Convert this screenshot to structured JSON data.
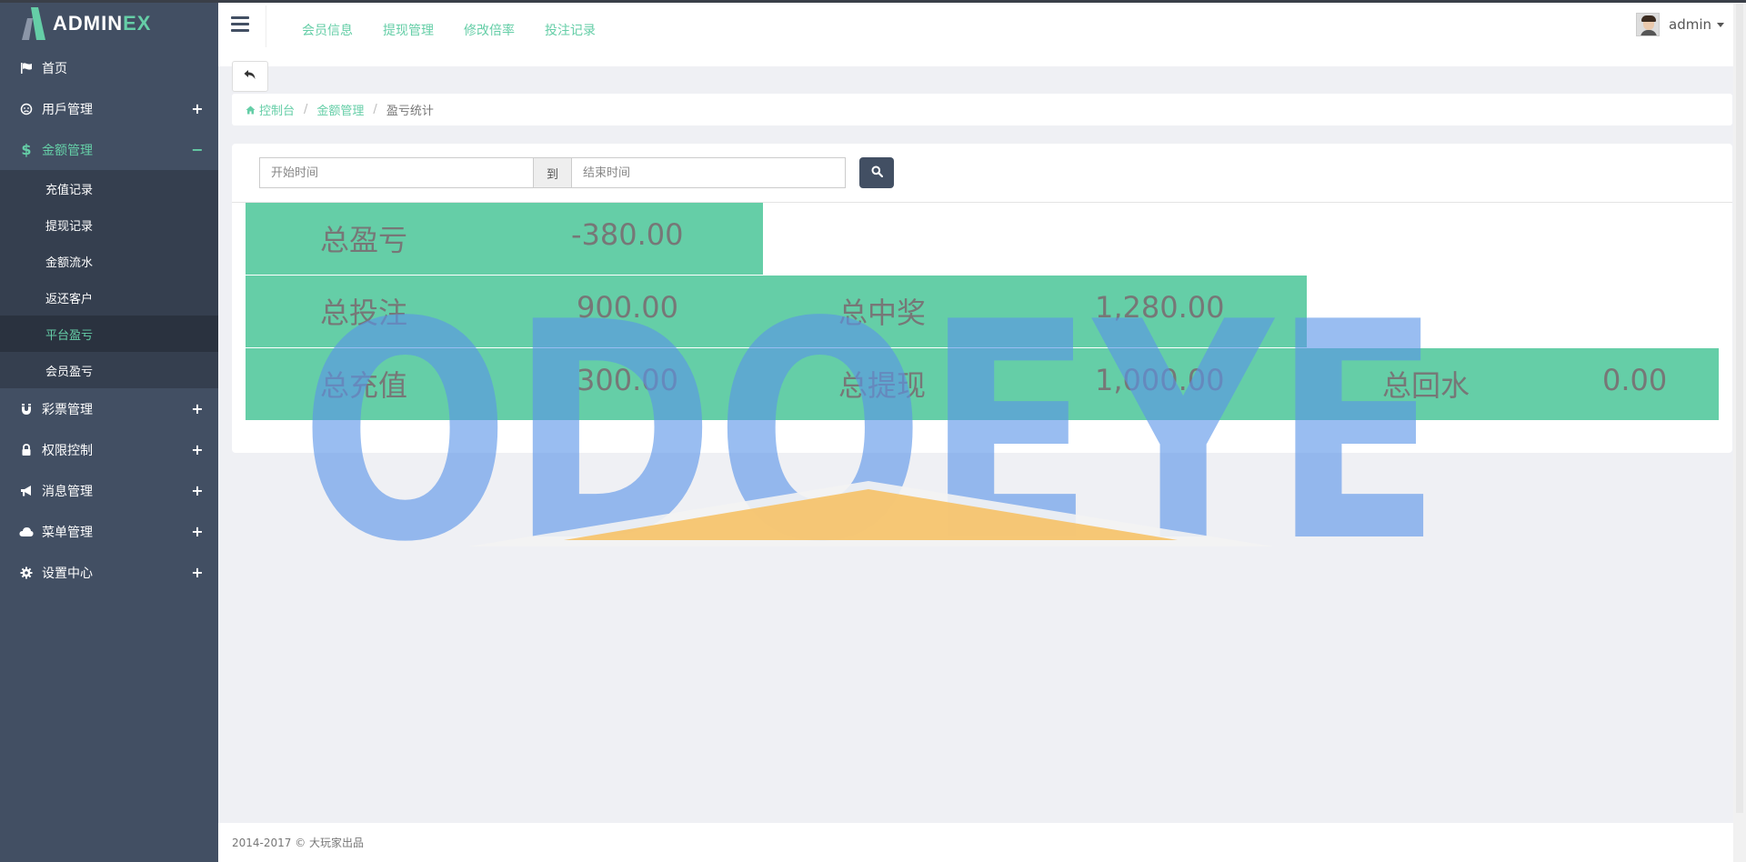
{
  "app": {
    "logo_main": "ADMIN",
    "logo_accent": "EX"
  },
  "sidebar": {
    "items": [
      {
        "label": "首页",
        "icon": "flag-icon",
        "toggle": ""
      },
      {
        "label": "用戶管理",
        "icon": "user-icon",
        "toggle": "+"
      },
      {
        "label": "金额管理",
        "icon": "dollar-icon",
        "toggle": "−",
        "active": true
      },
      {
        "label": "彩票管理",
        "icon": "magnet-icon",
        "toggle": "+"
      },
      {
        "label": "权限控制",
        "icon": "lock-icon",
        "toggle": "+"
      },
      {
        "label": "消息管理",
        "icon": "bullhorn-icon",
        "toggle": "+"
      },
      {
        "label": "菜单管理",
        "icon": "cloud-icon",
        "toggle": "+"
      },
      {
        "label": "设置中心",
        "icon": "gear-icon",
        "toggle": "+"
      }
    ],
    "sub_items": [
      "充值记录",
      "提现记录",
      "金额流水",
      "返还客户",
      "平台盈亏",
      "会员盈亏"
    ],
    "active_sub": "平台盈亏"
  },
  "header": {
    "menu": [
      "会员信息",
      "提现管理",
      "修改倍率",
      "投注记录"
    ],
    "user_name": "admin"
  },
  "breadcrumb": {
    "home": "控制台",
    "section": "金额管理",
    "current": "盈亏统计"
  },
  "search": {
    "start_placeholder": "开始时间",
    "to_label": "到",
    "end_placeholder": "结束时间"
  },
  "stats": {
    "row1": {
      "total_pl_label": "总盈亏",
      "total_pl_value": "-380.00"
    },
    "row2": {
      "total_bet_label": "总投注",
      "total_bet_value": "900.00",
      "total_win_label": "总中奖",
      "total_win_value": "1,280.00"
    },
    "row3": {
      "total_recharge_label": "总充值",
      "total_recharge_value": "300.00",
      "total_withdraw_label": "总提现",
      "total_withdraw_value": "1,000.00",
      "total_rebate_label": "总回水",
      "total_rebate_value": "0.00"
    }
  },
  "watermark": {
    "text": "ODOEYE"
  },
  "footer": {
    "text": "2014-2017 © 大玩家出品"
  },
  "colors": {
    "accent": "#65cea7",
    "sidebar": "#424f63",
    "stat_bg": "#65cea7"
  }
}
